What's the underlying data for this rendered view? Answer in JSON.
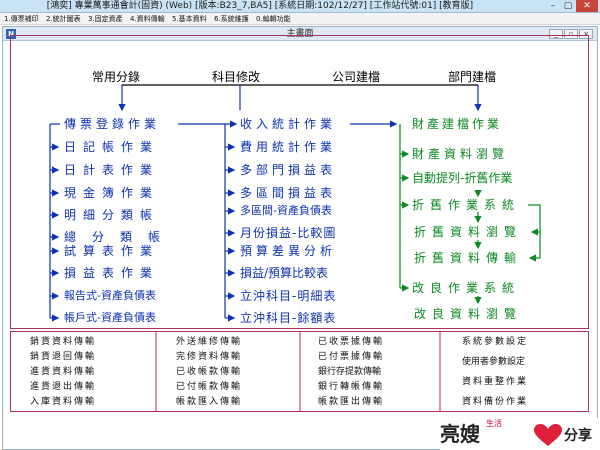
{
  "window": {
    "title": "[鴻奕] 專業萬事通會計(固資) (Web) [版本:B23_7,BA5] [系統日期:102/12/27] [工作站代號:01] [教育版]",
    "min": "–",
    "max": "▢",
    "close": "✕"
  },
  "menu": [
    "1.傳票補印",
    "2.統計圖表",
    "3.固定資產",
    "4.資料傳輸",
    "5.基本資料",
    "6.系統維護",
    "0.編輯功能"
  ],
  "inner": {
    "title": "主畫面",
    "icon": "N",
    "min": "_",
    "max": "▫",
    "close": "×"
  },
  "headers": {
    "common": "常用分錄",
    "subject": "科目修改",
    "company": "公司建檔",
    "dept": "部門建檔"
  },
  "col1": [
    "傳票登錄作業",
    "日記帳作業",
    "日計表作業",
    "現金簿作業",
    "明細分類帳",
    "總分類帳",
    "試算表作業",
    "損益表作業",
    "報告式-資產負債表",
    "帳戶式-資產負債表"
  ],
  "col2": [
    "收入統計作業",
    "費用統計作業",
    "多部門損益表",
    "多區間損益表",
    "多區間-資產負債表",
    "月份損益-比較圖",
    "預算差異分析",
    "損益/預算比較表",
    "立沖科目-明細表",
    "立沖科目-餘額表"
  ],
  "col3": [
    "財產建檔作業",
    "財產資料瀏覽",
    "自動提列-折舊作業",
    "折舊作業系統",
    "折舊資料瀏覽",
    "折舊資料傳輸",
    "改良作業系統",
    "改良資料瀏覽"
  ],
  "bottom": {
    "g1": [
      "銷貨資料傳輸",
      "銷貨退回傳輸",
      "進貨資料傳輸",
      "進貨退出傳輸",
      "入庫資料傳輸"
    ],
    "g2": [
      "外送維修傳輸",
      "完修資料傳輸",
      "已收帳款傳輸",
      "已付帳款傳輸",
      "帳款匯入傳輸"
    ],
    "g3": [
      "已收票據傳輸",
      "已付票據傳輸",
      "銀行存提款傳輸",
      "銀行轉帳傳輸",
      "帳款匯出傳輸"
    ],
    "g4": [
      "系統參數設定",
      "使用者參數設定",
      "資料重整作業",
      "資料備份作業"
    ]
  },
  "watermark": {
    "text": "亮嫂",
    "small": "生活",
    "tail": "分享"
  },
  "colors": {
    "blue": "#0f32b0",
    "green": "#0c8a23",
    "frame": "#b0305a",
    "heart": "#e0203a"
  }
}
